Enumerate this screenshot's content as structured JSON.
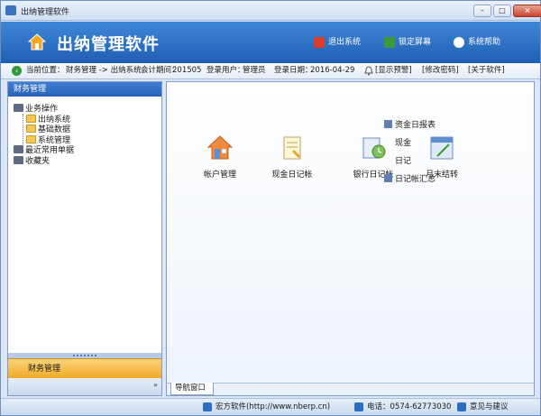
{
  "window": {
    "title": "出纳管理软件"
  },
  "header": {
    "title": "出纳管理软件",
    "buttons": [
      {
        "label": "退出系统",
        "icon": "exit-icon"
      },
      {
        "label": "锁定屏幕",
        "icon": "lock-icon"
      },
      {
        "label": "系统帮助",
        "icon": "help-icon"
      }
    ]
  },
  "infobar": {
    "location_label": "当前位置：",
    "location_path": "财务管理 -> 出纳系统",
    "period_label": "会计期间：",
    "period_value": "201505",
    "user_label": "登录用户：",
    "user_value": "管理员",
    "date_label": "登录日期：",
    "date_value": "2016-04-29",
    "links": [
      "[显示预警]",
      "[修改密码]",
      "[关于软件]"
    ]
  },
  "sidebar": {
    "header": "财务管理",
    "tree": [
      {
        "label": "业务操作",
        "level": 0,
        "icon": "document-icon"
      },
      {
        "label": "出纳系统",
        "level": 1,
        "icon": "folder-icon"
      },
      {
        "label": "基础数据",
        "level": 1,
        "icon": "folder-icon"
      },
      {
        "label": "系统管理",
        "level": 1,
        "icon": "folder-icon"
      },
      {
        "label": "最近常用单据",
        "level": 0,
        "icon": "document-icon"
      },
      {
        "label": "收藏夹",
        "level": 0,
        "icon": "document-icon"
      }
    ],
    "panel_label": "财务管理",
    "more_label": "»"
  },
  "main": {
    "items": [
      {
        "label": "帐户管理",
        "icon": "house-icon"
      },
      {
        "label": "现金日记帐",
        "icon": "cash-journal-icon"
      },
      {
        "label": "银行日记帐",
        "icon": "bank-journal-icon"
      },
      {
        "label": "月末结转",
        "icon": "month-end-icon"
      }
    ],
    "submenu": [
      "资金日报表",
      "现金",
      "日记",
      "日记帐汇总"
    ],
    "tab_label": "导航窗口"
  },
  "footer": {
    "company": "宏方软件(http://www.nberp.cn)",
    "phone": "电话：0574-62773030",
    "feedback": "意见与建议"
  },
  "colors": {
    "header_blue": "#2a6cc2",
    "panel_orange": "#f4b63d",
    "sidebar_head": "#3470c5"
  }
}
